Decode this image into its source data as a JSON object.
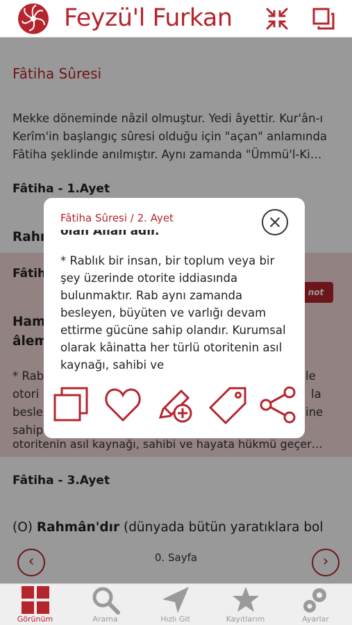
{
  "header": {
    "title": "Feyzü'l Furkan",
    "icons": [
      "logo-icon",
      "shrink-icon",
      "copy-icon"
    ]
  },
  "content": {
    "sura_title": "Fâtiha Sûresi",
    "intro": "Mekke döneminde nâzil olmuştur. Yedi âyettir. Kur'ân-ı Kerîm'in başlangıç sûresi olduğu için \"açan\" anlamında Fâtiha şeklinde anılmıştır.  Aynı zamanda \"Ümmü'l-Ki…",
    "ayet1_head": "Fâtiha - 1.Ayet",
    "ayet1_body": "Rahı",
    "ayet2_head": "Fâtih",
    "ayet2_body_line1": "Ham",
    "ayet2_body_line2": "âlem",
    "ayet2_note_p1": "* Rab",
    "ayet2_note_p2": "otori",
    "ayet2_note_p3": "besle",
    "ayet2_note_p4": "sahip",
    "ayet2_note_tail": "otoritenin asıl kaynağı, sahibi ve hayata hükmü geçer…",
    "ayet2_right1": "le",
    "ayet2_right2": "la",
    "ayet2_right3": "ine",
    "note_badge": "not",
    "ayet3_head": "Fâtiha - 3.Ayet",
    "ayet3_body_prefix": "(O) ",
    "ayet3_body_bold": "Rahmân'dır",
    "ayet3_body_rest": " (dünyada bütün yaratıklara bol"
  },
  "pager": {
    "label": "0. Sayfa",
    "prev_icon": "chevron-left-icon",
    "next_icon": "chevron-right-icon"
  },
  "popup": {
    "title": "Fâtiha Sûresi / 2. Ayet",
    "cut_line": "olan Allah'adır.",
    "body": "* Rablık bir insan, bir toplum veya bir şey üzerinde otorite iddiasında bulunmaktır. Rab aynı zamanda besleyen, büyüten ve varlığı devam ettirme gücüne sahip olandır. Kurumsal olarak kâinatta her türlü otoritenin asıl kaynağı, sahibi ve",
    "actions": [
      "copy-icon",
      "heart-icon",
      "add-note-icon",
      "tag-icon",
      "share-icon"
    ]
  },
  "tabbar": {
    "tabs": [
      {
        "label": "Görünüm",
        "icon": "grid-icon",
        "active": true
      },
      {
        "label": "Arama",
        "icon": "search-icon",
        "active": false
      },
      {
        "label": "Hızlı Git",
        "icon": "send-icon",
        "active": false
      },
      {
        "label": "Kayıtlarım",
        "icon": "star-icon",
        "active": false
      },
      {
        "label": "Ayarlar",
        "icon": "gear-icon",
        "active": false
      }
    ]
  },
  "colors": {
    "accent": "#b5252d",
    "highlight": "#f5d9d9",
    "tab_inactive": "#9a9a9a"
  }
}
